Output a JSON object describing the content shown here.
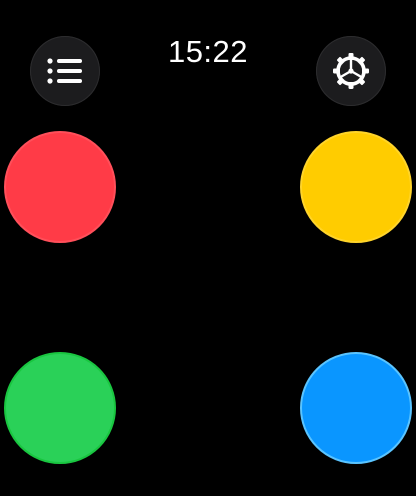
{
  "status": {
    "time": "15:22"
  },
  "toolbar": {
    "left_icon": "list-icon",
    "right_icon": "gear-icon"
  },
  "colors": [
    {
      "name": "red",
      "hex": "#ff3b47",
      "border": "#ff4f5a"
    },
    {
      "name": "yellow",
      "hex": "#ffcc00",
      "border": "#ffd42a"
    },
    {
      "name": "green",
      "hex": "#2ad158",
      "border": "#19c640"
    },
    {
      "name": "blue",
      "hex": "#0a96ff",
      "border": "#5ac4ff"
    }
  ]
}
